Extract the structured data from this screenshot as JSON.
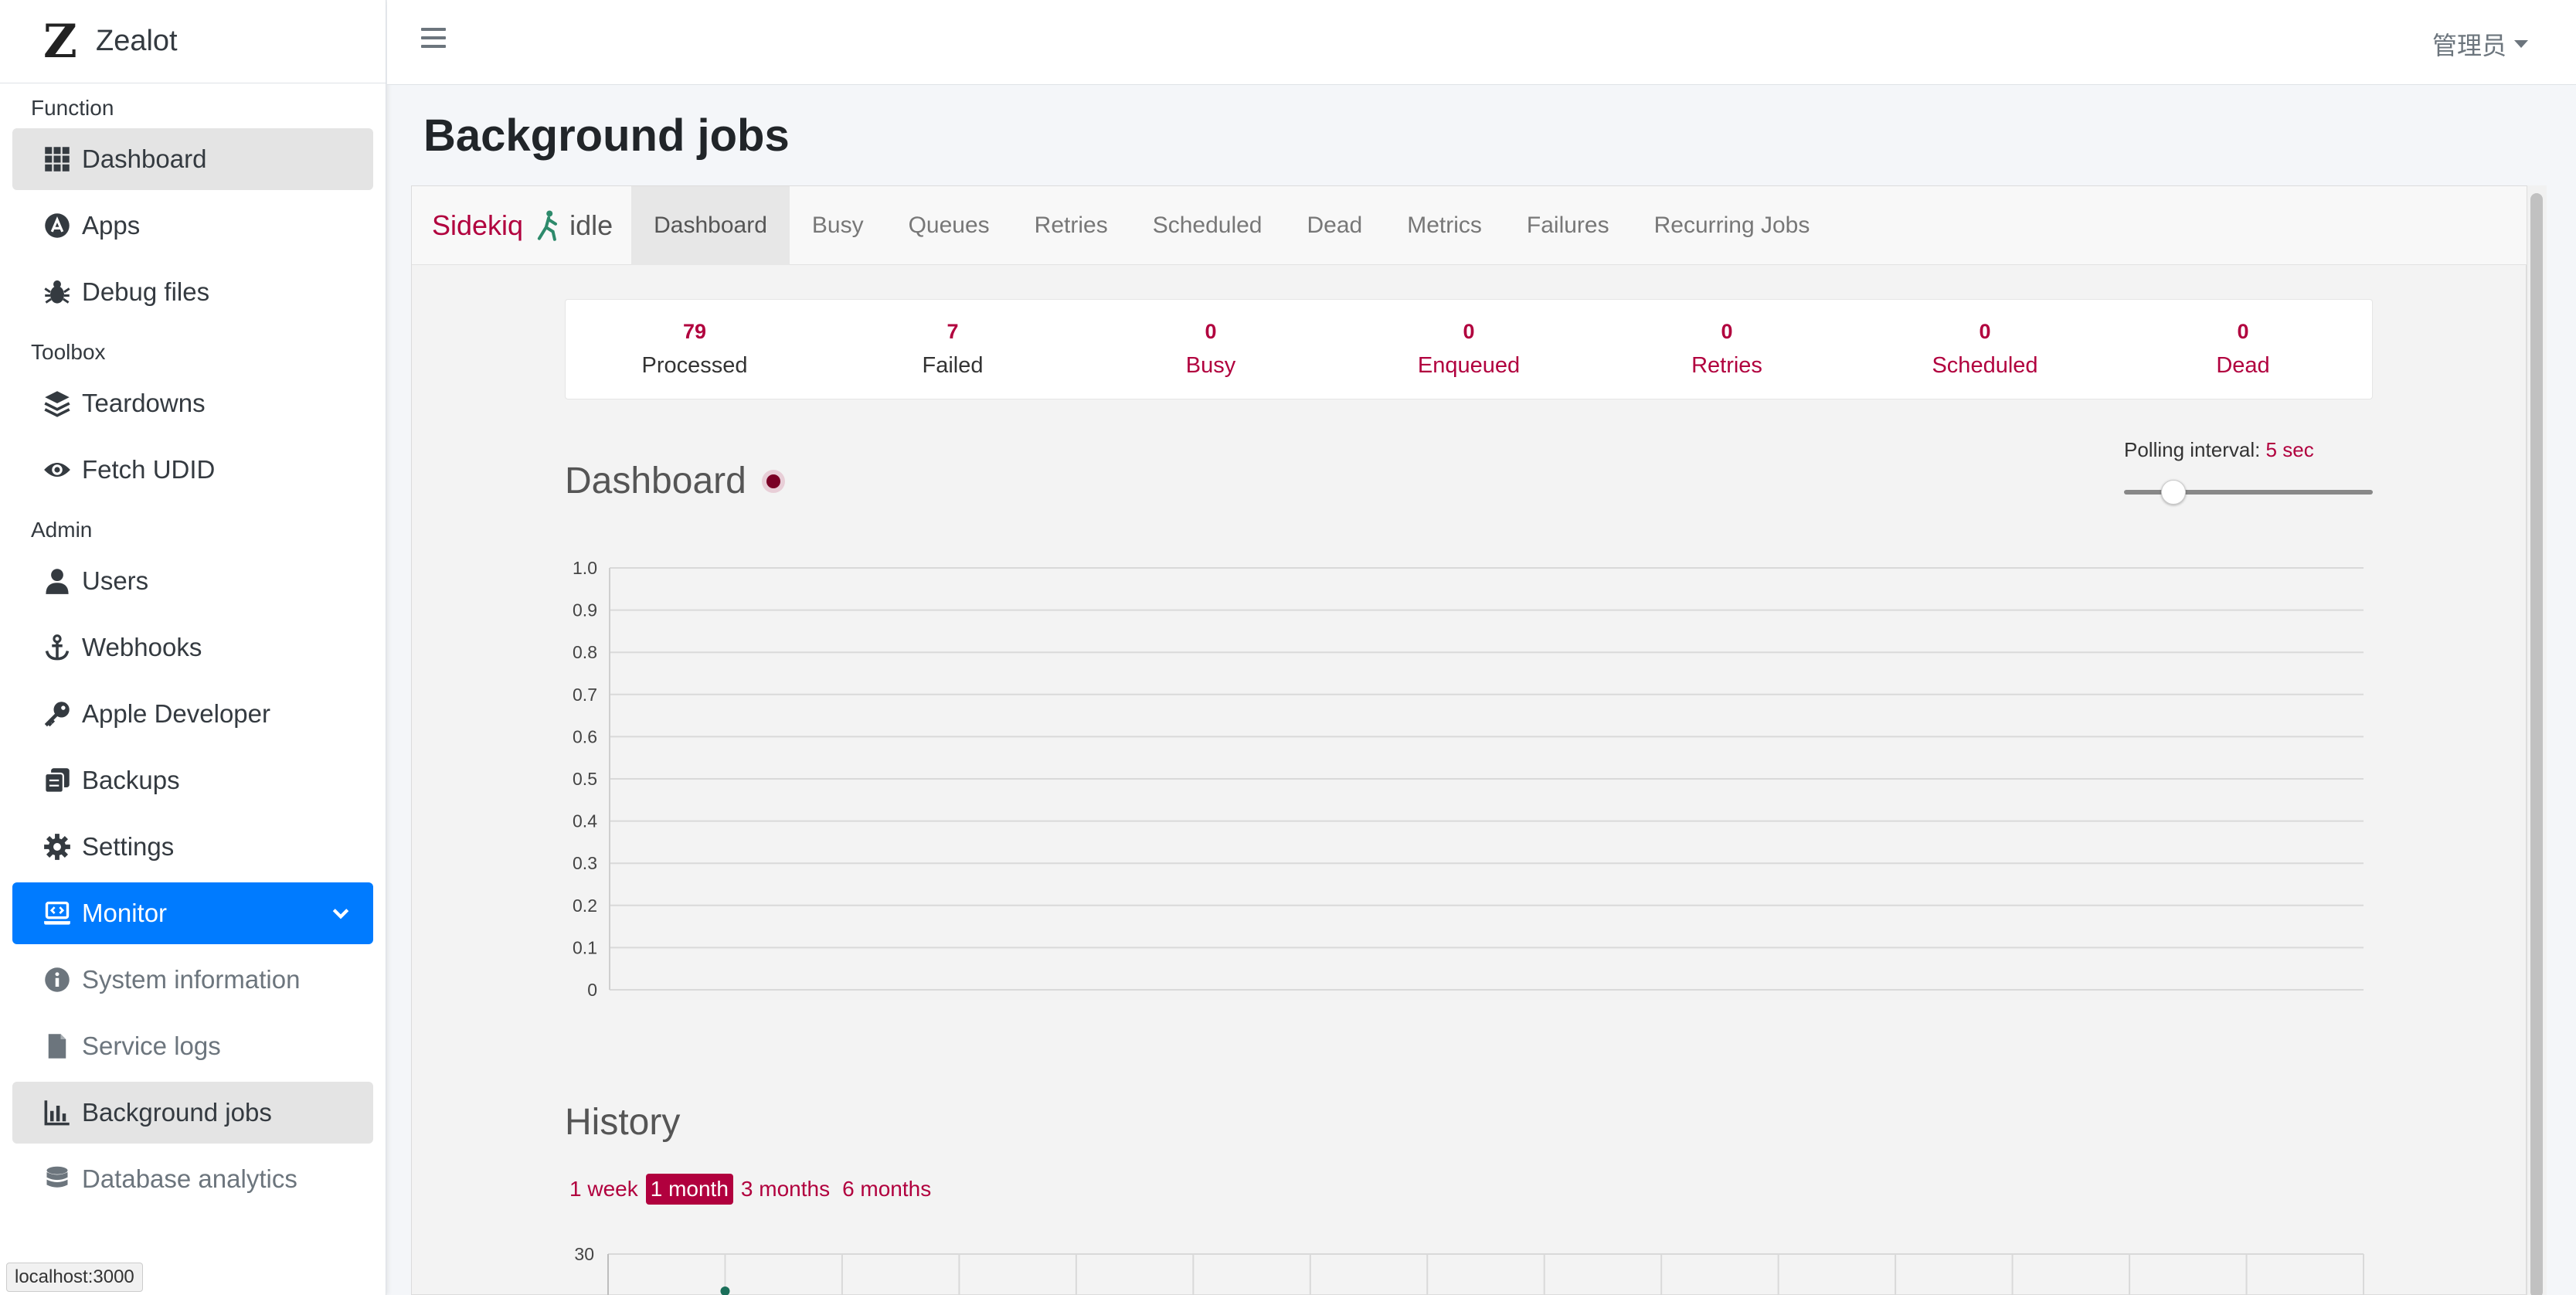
{
  "brand": {
    "name": "Zealot",
    "logo_letter": "Z"
  },
  "sidebar": {
    "sections": [
      {
        "header": "Function",
        "items": [
          {
            "label": "Dashboard",
            "icon": "grid-icon"
          },
          {
            "label": "Apps",
            "icon": "app-store-icon"
          },
          {
            "label": "Debug files",
            "icon": "bug-icon"
          }
        ]
      },
      {
        "header": "Toolbox",
        "items": [
          {
            "label": "Teardowns",
            "icon": "layers-icon"
          },
          {
            "label": "Fetch UDID",
            "icon": "eye-icon"
          }
        ]
      },
      {
        "header": "Admin",
        "items": [
          {
            "label": "Users",
            "icon": "user-icon"
          },
          {
            "label": "Webhooks",
            "icon": "anchor-icon"
          },
          {
            "label": "Apple Developer",
            "icon": "key-icon"
          },
          {
            "label": "Backups",
            "icon": "copy-icon"
          },
          {
            "label": "Settings",
            "icon": "gear-icon"
          },
          {
            "label": "Monitor",
            "icon": "laptop-code-icon"
          },
          {
            "label": "System information",
            "icon": "info-circle-icon"
          },
          {
            "label": "Service logs",
            "icon": "file-icon"
          },
          {
            "label": "Background jobs",
            "icon": "bar-chart-icon"
          },
          {
            "label": "Database analytics",
            "icon": "database-icon"
          }
        ]
      }
    ]
  },
  "status_url": "localhost:3000",
  "topbar": {
    "user": "管理员"
  },
  "page": {
    "title": "Background jobs"
  },
  "sidekiq": {
    "name": "Sidekiq",
    "state": "idle",
    "tabs": [
      "Dashboard",
      "Busy",
      "Queues",
      "Retries",
      "Scheduled",
      "Dead",
      "Metrics",
      "Failures",
      "Recurring Jobs"
    ],
    "active_tab": "Dashboard",
    "stats": [
      {
        "value": "79",
        "label": "Processed"
      },
      {
        "value": "7",
        "label": "Failed"
      },
      {
        "value": "0",
        "label": "Busy"
      },
      {
        "value": "0",
        "label": "Enqueued"
      },
      {
        "value": "0",
        "label": "Retries"
      },
      {
        "value": "0",
        "label": "Scheduled"
      },
      {
        "value": "0",
        "label": "Dead"
      }
    ],
    "dashboard_title": "Dashboard",
    "polling": {
      "label": "Polling interval:",
      "value": "5 sec",
      "slider_fraction": 0.2
    },
    "history_title": "History",
    "ranges": [
      "1 week",
      "1 month",
      "3 months",
      "6 months"
    ],
    "active_range": "1 month",
    "colors": {
      "accent": "#b1003e",
      "active_nav": "#007bff"
    }
  },
  "chart_data": [
    {
      "type": "line",
      "title": "",
      "xlabel": "",
      "ylabel": "",
      "ylim": [
        0,
        1.0
      ],
      "yticks": [
        "1.0",
        "0.9",
        "0.8",
        "0.7",
        "0.6",
        "0.5",
        "0.4",
        "0.3",
        "0.2",
        "0.1",
        "0"
      ],
      "series": [],
      "grid": true
    },
    {
      "type": "line",
      "title": "",
      "yticks_visible": [
        "30"
      ],
      "series": [],
      "grid": true
    }
  ]
}
